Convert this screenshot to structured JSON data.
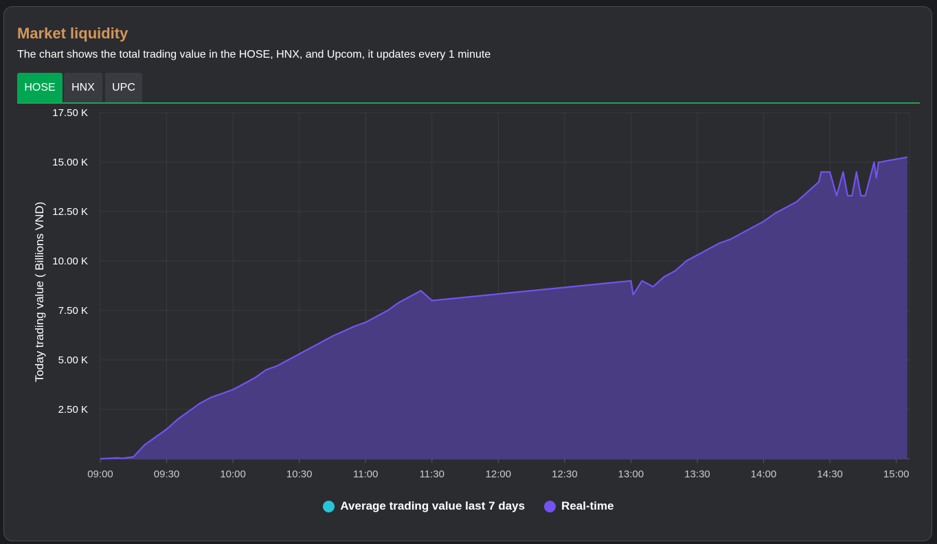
{
  "panel": {
    "title": "Market liquidity",
    "subtitle": "The chart shows the total trading value in the HOSE, HNX, and Upcom, it updates every 1 minute"
  },
  "tabs": [
    {
      "label": "HOSE",
      "active": true
    },
    {
      "label": "HNX",
      "active": false
    },
    {
      "label": "UPC",
      "active": false
    }
  ],
  "colors": {
    "accent_tab": "#00a651",
    "title": "#d4975a",
    "realtime_line": "#7453f0",
    "realtime_fill": "#4b3d88",
    "average_series": "#26c6da"
  },
  "chart_data": {
    "type": "area",
    "title": "",
    "xlabel": "",
    "ylabel": "Today trading value ( Billions VND)",
    "x_ticks": [
      "09:00",
      "09:30",
      "10:00",
      "10:30",
      "11:00",
      "11:30",
      "12:00",
      "12:30",
      "13:00",
      "13:30",
      "14:00",
      "14:30",
      "15:00"
    ],
    "y_ticks": [
      "2.50 K",
      "5.00 K",
      "7.50 K",
      "10.00 K",
      "12.50 K",
      "15.00 K",
      "17.50 K"
    ],
    "xlim": [
      "09:00",
      "15:06"
    ],
    "ylim": [
      0,
      17500
    ],
    "grid": true,
    "legend_position": "bottom-center",
    "series": [
      {
        "name": "Average trading value last 7 days",
        "color": "#26c6da",
        "x": [],
        "values": []
      },
      {
        "name": "Real-time",
        "color": "#7453f0",
        "x": [
          "09:00",
          "09:08",
          "09:10",
          "09:15",
          "09:20",
          "09:25",
          "09:30",
          "09:35",
          "09:40",
          "09:45",
          "09:50",
          "09:55",
          "10:00",
          "10:05",
          "10:10",
          "10:15",
          "10:20",
          "10:25",
          "10:30",
          "10:35",
          "10:40",
          "10:45",
          "10:50",
          "10:55",
          "11:00",
          "11:05",
          "11:10",
          "11:15",
          "11:20",
          "11:25",
          "11:30",
          "13:00",
          "13:01",
          "13:05",
          "13:10",
          "13:15",
          "13:20",
          "13:25",
          "13:30",
          "13:35",
          "13:40",
          "13:45",
          "13:50",
          "13:55",
          "14:00",
          "14:05",
          "14:10",
          "14:15",
          "14:20",
          "14:25",
          "14:26",
          "14:30",
          "14:33",
          "14:36",
          "14:38",
          "14:40",
          "14:42",
          "14:44",
          "14:46",
          "14:50",
          "14:51",
          "14:52",
          "14:53",
          "14:55",
          "15:00",
          "15:05"
        ],
        "values": [
          0,
          50,
          20,
          100,
          700,
          1100,
          1500,
          2000,
          2400,
          2800,
          3100,
          3300,
          3500,
          3800,
          4100,
          4500,
          4700,
          5000,
          5300,
          5600,
          5900,
          6200,
          6450,
          6700,
          6900,
          7200,
          7500,
          7900,
          8200,
          8500,
          8000,
          9000,
          8300,
          9000,
          8700,
          9200,
          9500,
          10000,
          10300,
          10600,
          10900,
          11100,
          11400,
          11700,
          12000,
          12400,
          12700,
          13000,
          13500,
          14000,
          14500,
          14500,
          13300,
          14500,
          13300,
          13300,
          14500,
          13300,
          13300,
          15000,
          14200,
          15000,
          15000,
          15050,
          15150,
          15250
        ]
      }
    ]
  }
}
